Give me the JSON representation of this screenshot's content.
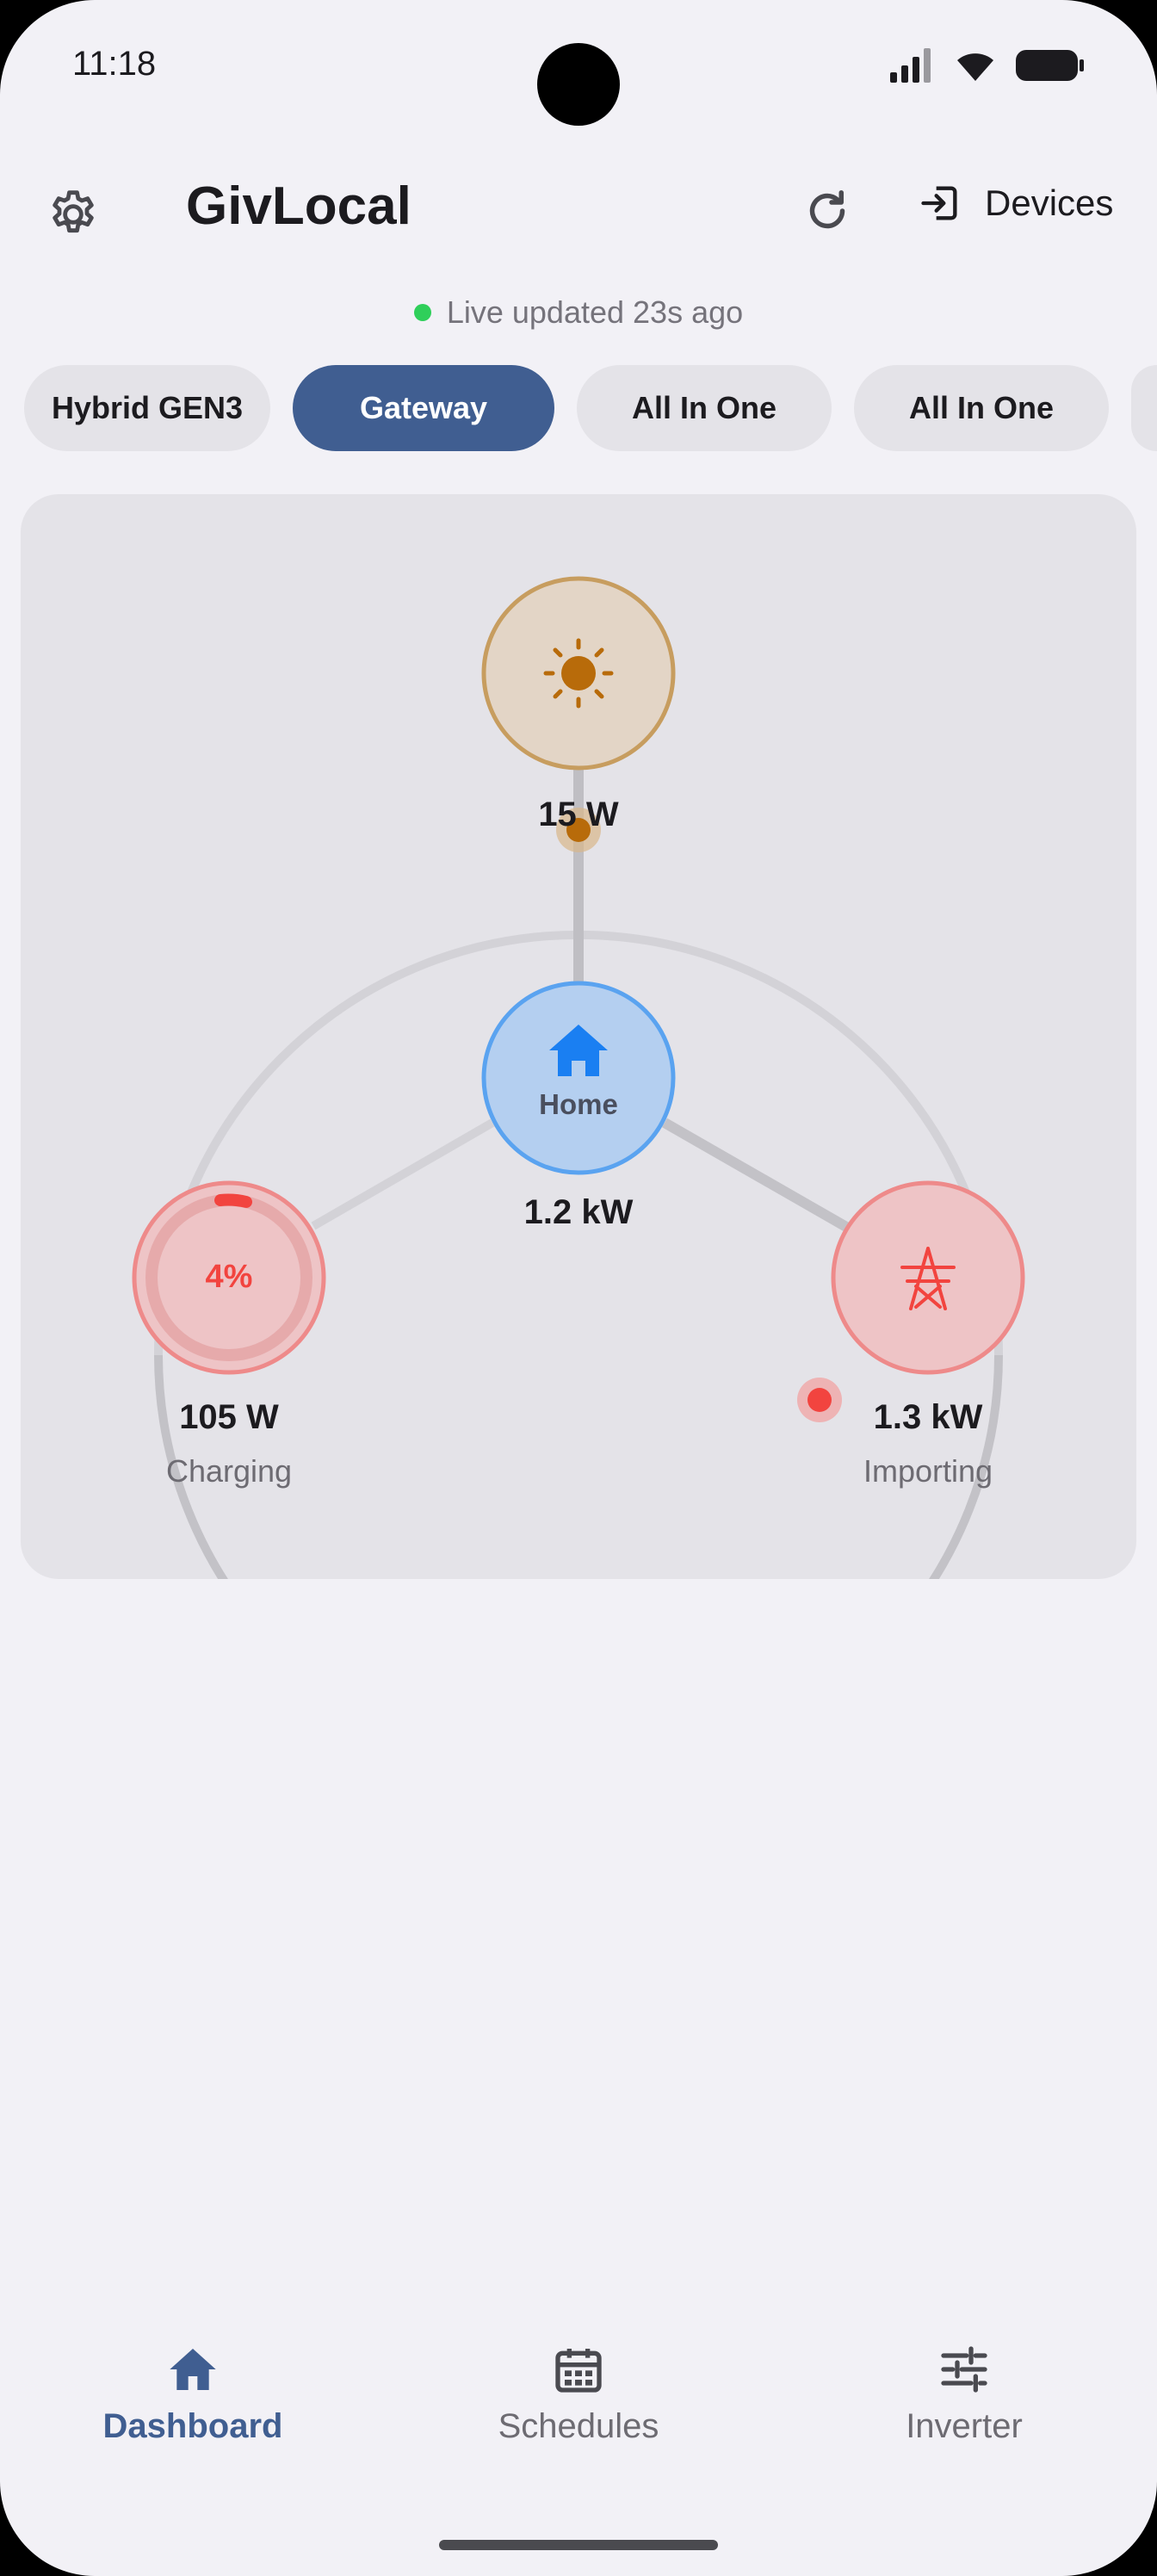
{
  "status_bar": {
    "time": "11:18"
  },
  "app_bar": {
    "title": "GivLocal",
    "devices_label": "Devices",
    "settings_icon": "gear-icon",
    "refresh_icon": "refresh-icon",
    "devices_icon": "login-arrow-icon"
  },
  "live": {
    "text": "Live updated 23s ago",
    "dot_color": "#2fcf5a"
  },
  "chips": [
    {
      "label": "Hybrid GEN3",
      "active": false
    },
    {
      "label": "Gateway",
      "active": true
    },
    {
      "label": "All In One",
      "active": false
    },
    {
      "label": "All In One",
      "active": false
    }
  ],
  "flow": {
    "solar": {
      "value": "15 W",
      "icon": "sun-icon",
      "color": "#b86b0a"
    },
    "home": {
      "label": "Home",
      "value": "1.2 kW",
      "icon": "house-icon",
      "color": "#1a7ff2"
    },
    "battery": {
      "percent": "4%",
      "value": "105 W",
      "status": "Charging",
      "color": "#f2443f"
    },
    "grid": {
      "value": "1.3 kW",
      "status": "Importing",
      "icon": "pylon-icon",
      "color": "#f2443f"
    }
  },
  "nav": [
    {
      "label": "Dashboard",
      "icon": "house-icon",
      "active": true
    },
    {
      "label": "Schedules",
      "icon": "calendar-icon",
      "active": false
    },
    {
      "label": "Inverter",
      "icon": "sliders-icon",
      "active": false
    }
  ],
  "colors": {
    "accent": "#405e91",
    "background": "#f2f1f6",
    "card": "#e4e3e8"
  }
}
